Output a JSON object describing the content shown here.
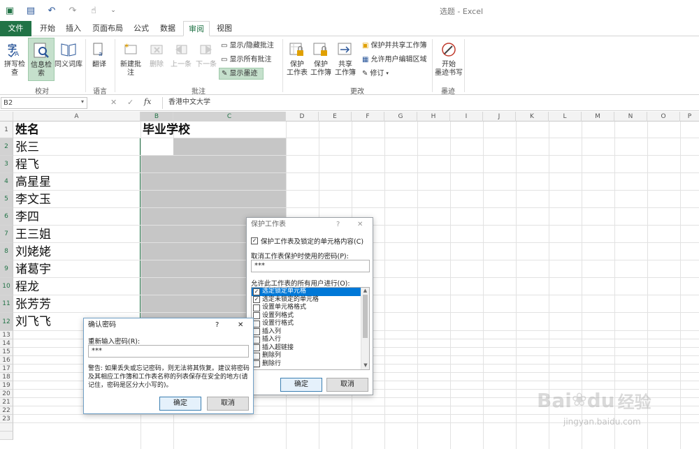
{
  "title_bar": {
    "app_title": "选题 - Excel"
  },
  "tabs": [
    "文件",
    "开始",
    "插入",
    "页面布局",
    "公式",
    "数据",
    "审阅",
    "视图"
  ],
  "ribbon": {
    "proofing": {
      "spell": "拼写检查",
      "research": "信息检索",
      "thesaurus": "同义词库",
      "group": "校对"
    },
    "language": {
      "translate": "翻译",
      "group": "语言"
    },
    "comments": {
      "new": "新建批注",
      "delete": "删除",
      "prev": "上一条",
      "next": "下一条",
      "show_hide": "显示/隐藏批注",
      "show_all": "显示所有批注",
      "show_ink": "显示墨迹",
      "group": "批注"
    },
    "changes": {
      "protect_sheet_1": "保护",
      "protect_sheet_2": "工作表",
      "protect_wb_1": "保护",
      "protect_wb_2": "工作簿",
      "share_1": "共享",
      "share_2": "工作簿",
      "protect_share": "保护并共享工作簿",
      "allow_edit": "允许用户编辑区域",
      "track": "修订",
      "group": "更改"
    },
    "ink": {
      "start_1": "开始",
      "start_2": "墨迹书写",
      "group": "墨迹"
    }
  },
  "formula_bar": {
    "name_box": "B2",
    "formula": "香港中文大学"
  },
  "columns": [
    "A",
    "B",
    "C",
    "D",
    "E",
    "F",
    "G",
    "H",
    "I",
    "J",
    "K",
    "L",
    "M",
    "N",
    "O",
    "P"
  ],
  "rows": [
    "1",
    "2",
    "3",
    "4",
    "5",
    "6",
    "7",
    "8",
    "9",
    "10",
    "11",
    "12",
    "13",
    "14",
    "15",
    "16",
    "17",
    "18",
    "19",
    "20",
    "21",
    "22",
    "23"
  ],
  "cells": {
    "A1": "姓名",
    "C1": "毕业学校",
    "A2": "张三",
    "A3": "程飞",
    "A4": "高星星",
    "A5": "李文玉",
    "A6": "李四",
    "A7": "王三姐",
    "A8": "刘姥姥",
    "A9": "诸葛宇",
    "A10": "程龙",
    "A11": "张芳芳",
    "A12": "刘飞飞"
  },
  "protect_dialog": {
    "title": "保护工作表",
    "help": "?",
    "close": "✕",
    "protect_check": "保护工作表及锁定的单元格内容(C)",
    "pwd_label": "取消工作表保护时使用的密码(P):",
    "pwd_value": "***",
    "allow_label": "允许此工作表的所有用户进行(O):",
    "options": [
      {
        "label": "选定锁定单元格",
        "checked": true,
        "selected": true
      },
      {
        "label": "选定未锁定的单元格",
        "checked": true,
        "selected": false
      },
      {
        "label": "设置单元格格式",
        "checked": false,
        "selected": false
      },
      {
        "label": "设置列格式",
        "checked": false,
        "selected": false
      },
      {
        "label": "设置行格式",
        "checked": false,
        "selected": false
      },
      {
        "label": "插入列",
        "checked": false,
        "selected": false
      },
      {
        "label": "插入行",
        "checked": false,
        "selected": false
      },
      {
        "label": "插入超链接",
        "checked": false,
        "selected": false
      },
      {
        "label": "删除列",
        "checked": false,
        "selected": false
      },
      {
        "label": "删除行",
        "checked": false,
        "selected": false
      }
    ],
    "ok": "确定",
    "cancel": "取消"
  },
  "confirm_dialog": {
    "title": "确认密码",
    "help": "?",
    "close": "✕",
    "label": "重新输入密码(R):",
    "value": "***",
    "warning": "警告: 如果丢失或忘记密码，则无法将其恢复。建议将密码及其相应工作簿和工作表名称的列表保存在安全的地方(请记住，密码是区分大小写的)。",
    "ok": "确定",
    "cancel": "取消"
  },
  "watermark": {
    "brand": "Bai",
    "brand2": "du",
    "brand3": "经验",
    "url": "jingyan.baidu.com"
  },
  "colors": {
    "excel_green": "#217346",
    "select_blue": "#0078d7",
    "range_gray": "#c6c6c6"
  }
}
